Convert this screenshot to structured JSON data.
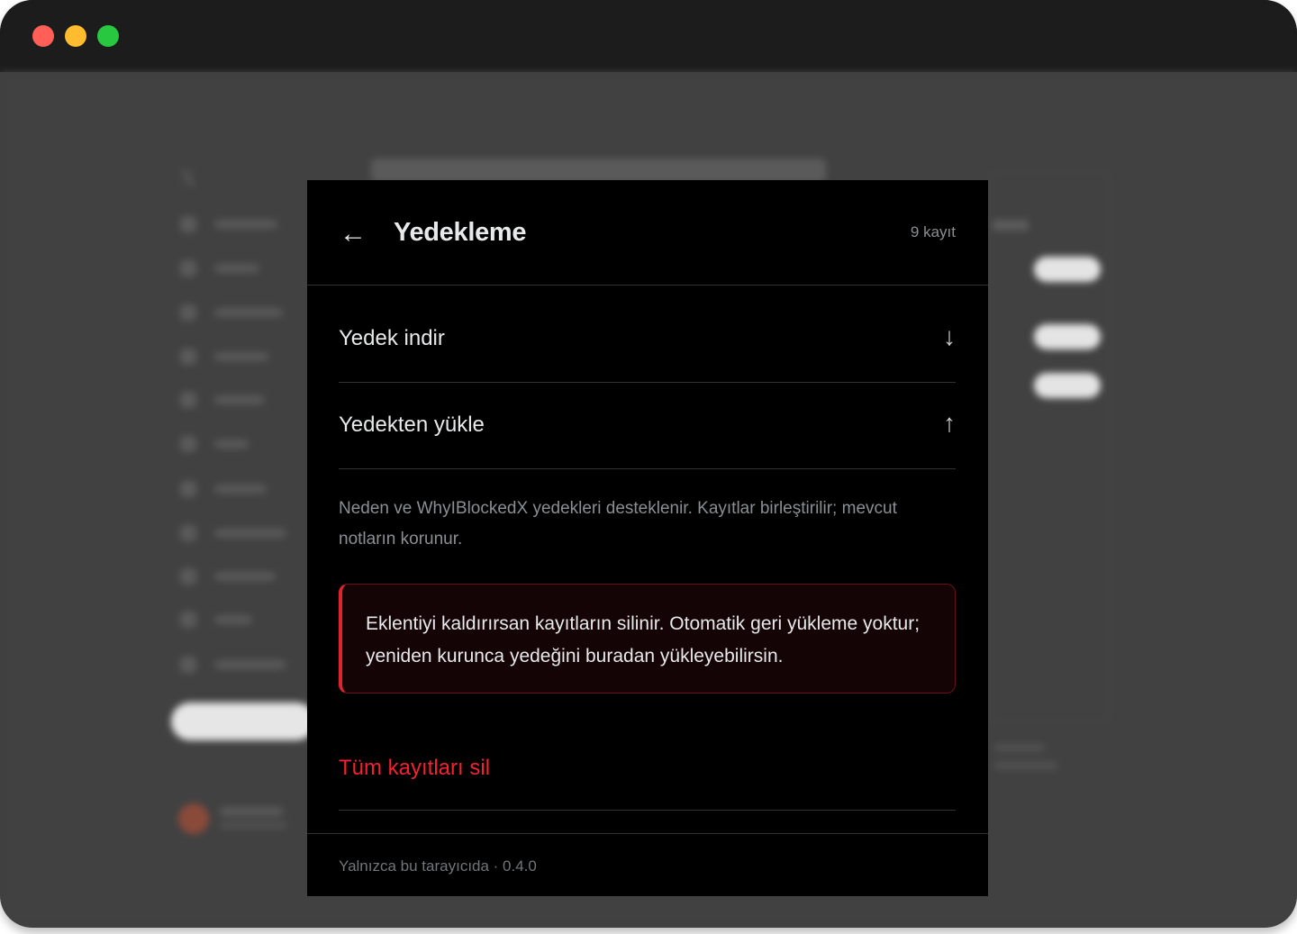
{
  "window": {
    "traffic_lights": [
      "close",
      "minimize",
      "zoom"
    ]
  },
  "popup": {
    "back_icon": "←",
    "title": "Yedekleme",
    "record_count": "9 kayıt",
    "actions": [
      {
        "label": "Yedek indir",
        "icon": "↓"
      },
      {
        "label": "Yedekten yükle",
        "icon": "↑"
      }
    ],
    "info": "Neden ve WhyIBlockedX yedekleri desteklenir. Kayıtlar birleştirilir; mevcut notların korunur.",
    "warning": "Eklentiyi kaldırırsan kayıtların silinir. Otomatik geri yükleme yoktur; yeniden kurunca yedeğini buradan yükleyebilirsin.",
    "delete_all": "Tüm kayıtları sil",
    "footer": "Yalnızca bu tarayıcıda · 0.4.0"
  },
  "colors": {
    "accent_red": "#f4212e",
    "warning_border": "#e0242e",
    "popup_bg": "#000000",
    "text_primary": "#e7e9ea",
    "text_secondary": "#8b8f93"
  }
}
